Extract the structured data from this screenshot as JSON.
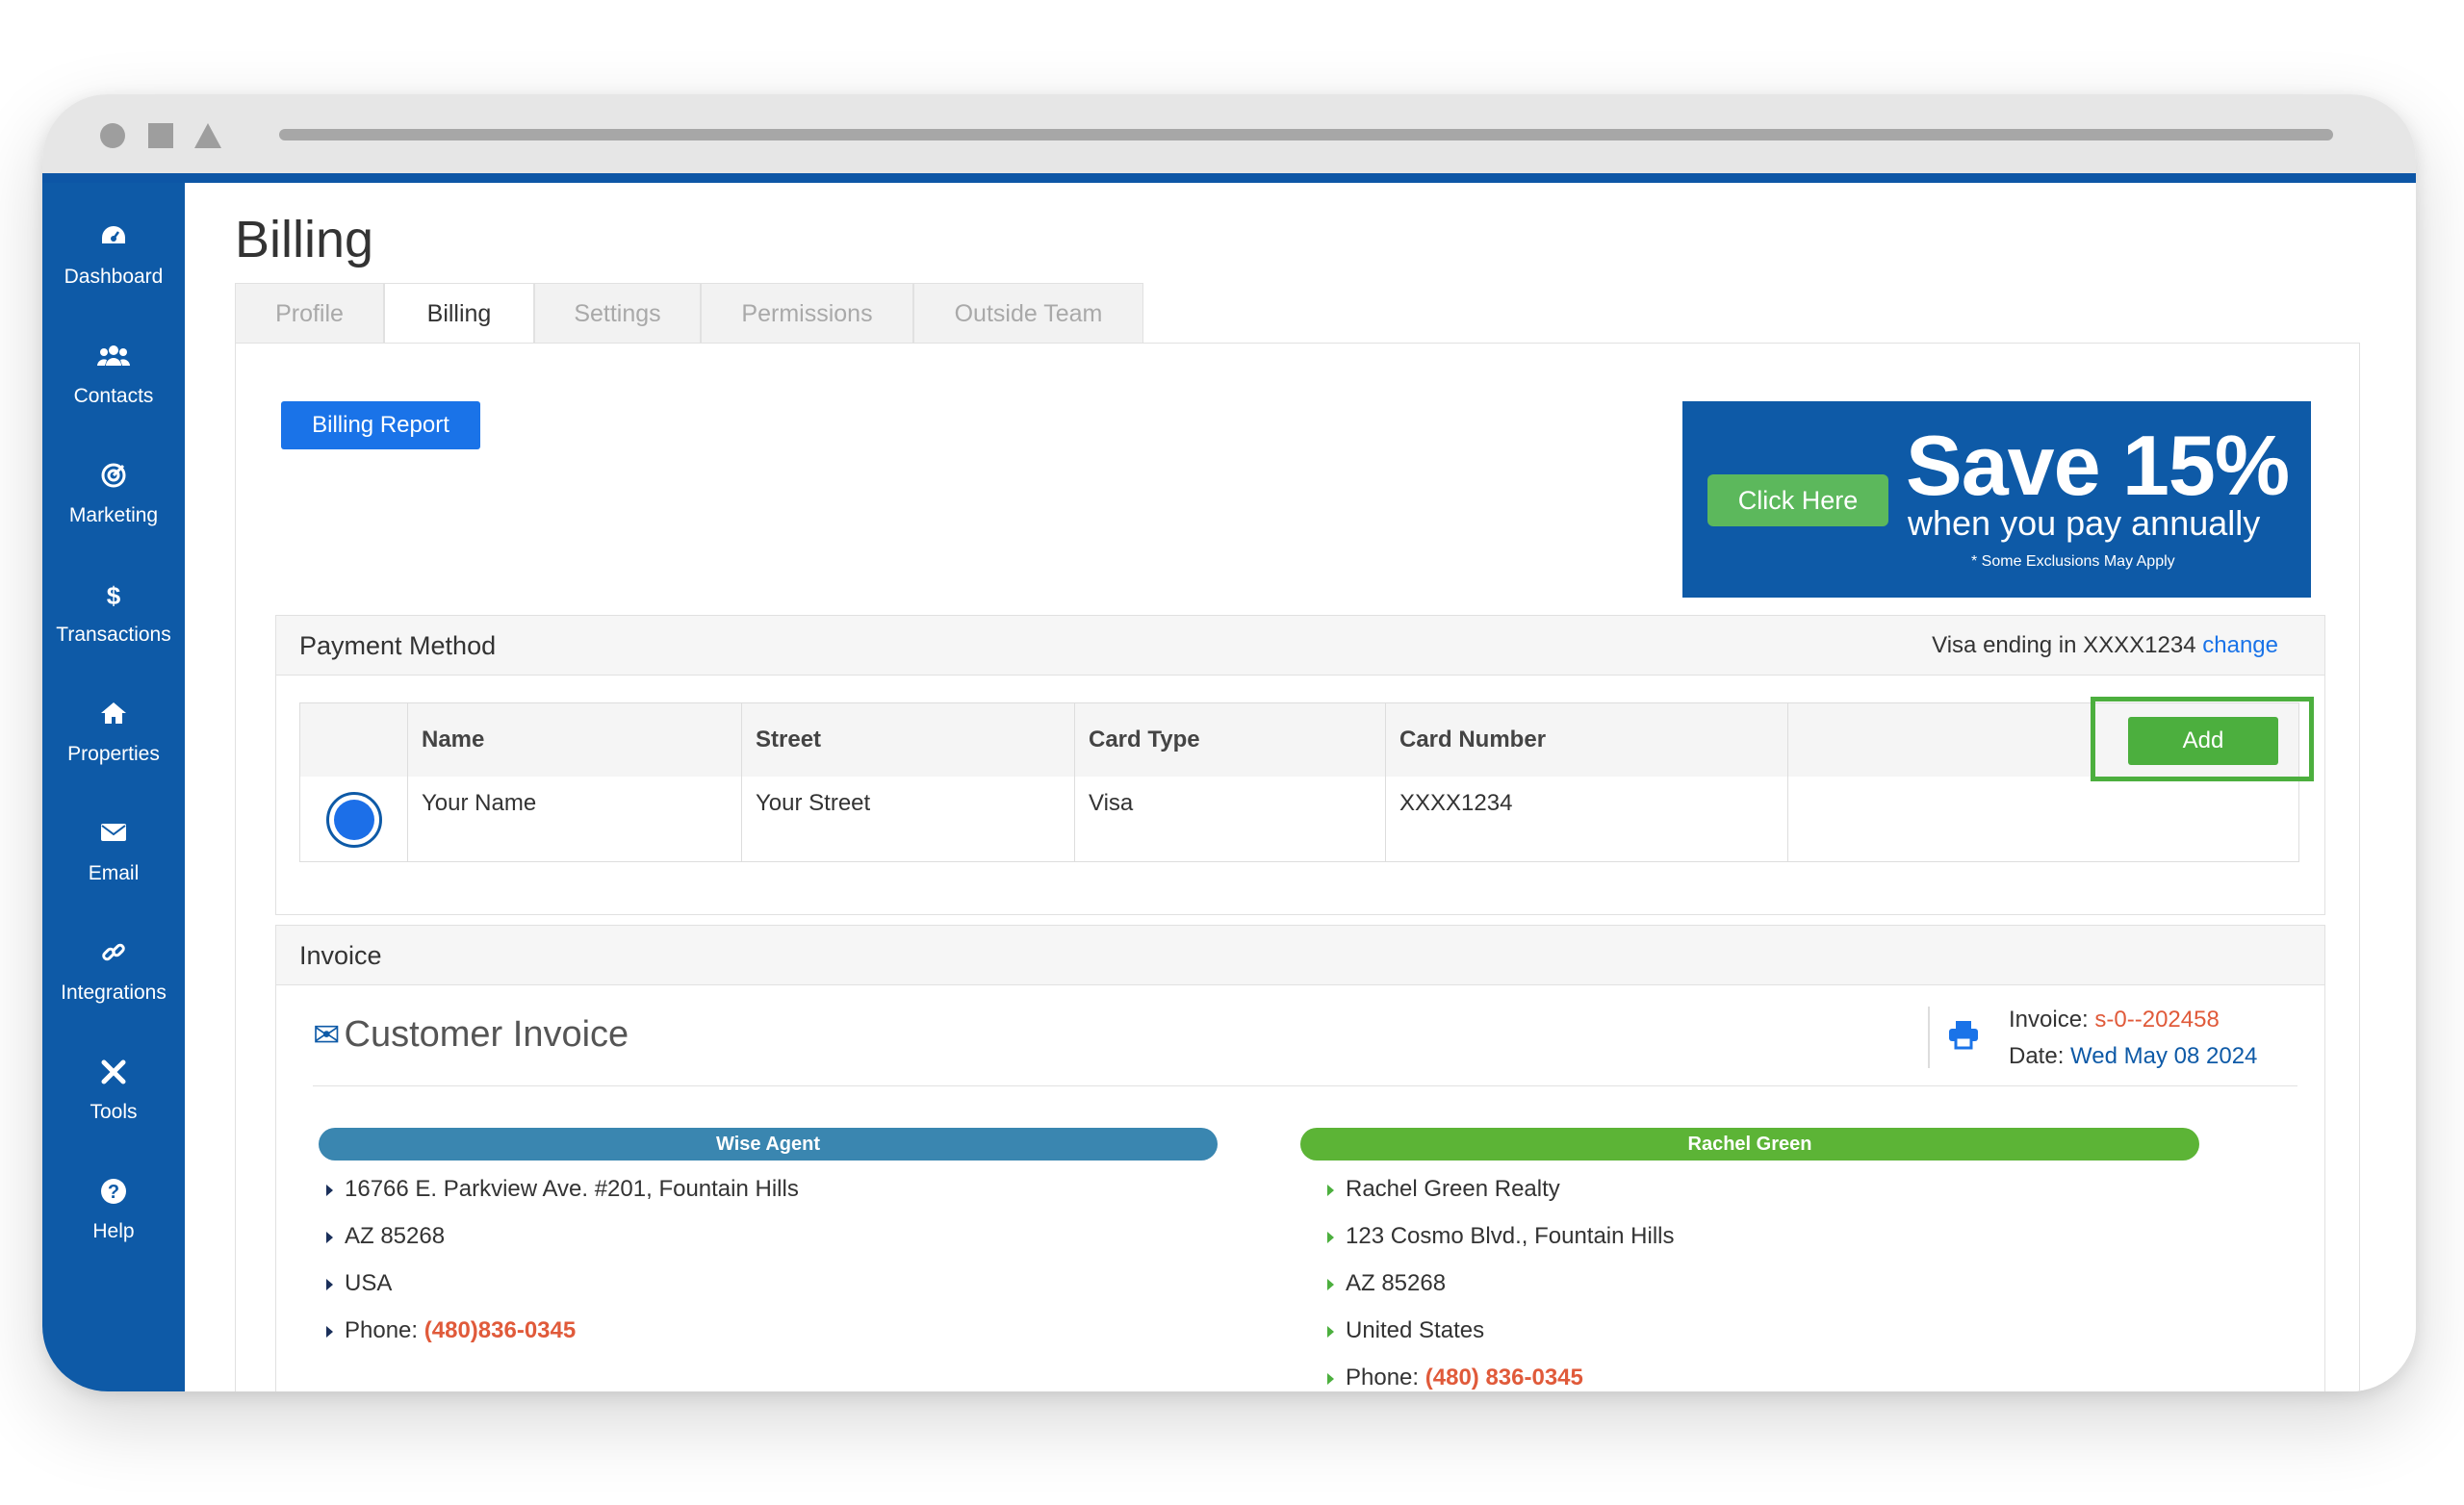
{
  "page": {
    "title": "Billing"
  },
  "tabs": [
    {
      "label": "Profile",
      "active": false
    },
    {
      "label": "Billing",
      "active": true
    },
    {
      "label": "Settings",
      "active": false
    },
    {
      "label": "Permissions",
      "active": false
    },
    {
      "label": "Outside Team",
      "active": false
    }
  ],
  "sidebar": {
    "items": [
      {
        "label": "Dashboard",
        "icon": "dashboard-icon"
      },
      {
        "label": "Contacts",
        "icon": "contacts-icon"
      },
      {
        "label": "Marketing",
        "icon": "marketing-icon"
      },
      {
        "label": "Transactions",
        "icon": "dollar-icon"
      },
      {
        "label": "Properties",
        "icon": "home-icon"
      },
      {
        "label": "Email",
        "icon": "envelope-icon"
      },
      {
        "label": "Integrations",
        "icon": "link-icon"
      },
      {
        "label": "Tools",
        "icon": "tools-icon"
      },
      {
        "label": "Help",
        "icon": "help-icon"
      }
    ]
  },
  "billing_report": {
    "label": "Billing Report"
  },
  "promo": {
    "cta": "Click Here",
    "headline": "Save 15%",
    "subline": "when you pay annually",
    "fine": "* Some Exclusions May Apply"
  },
  "payment": {
    "title": "Payment Method",
    "visa_text": "Visa ending in XXXX1234",
    "change_label": "change",
    "add_label": "Add",
    "columns": [
      "Name",
      "Street",
      "Card Type",
      "Card Number"
    ],
    "row": {
      "name": "Your Name",
      "street": "Your Street",
      "card_type": "Visa",
      "card_number": "XXXX1234"
    }
  },
  "invoice": {
    "section_title": "Invoice",
    "title": "Customer Invoice",
    "invoice_label": "Invoice:",
    "invoice_number": "s-0--202458",
    "date_label": "Date:",
    "date_value": "Wed May 08 2024",
    "from": {
      "name": "Wise Agent",
      "address": "16766 E. Parkview Ave. #201, Fountain Hills",
      "state_zip": "AZ  85268",
      "country": "USA",
      "phone_label": "Phone:",
      "phone": "(480)836-0345"
    },
    "to": {
      "name": "Rachel Green",
      "company": "Rachel Green Realty",
      "address": "123 Cosmo Blvd., Fountain Hills",
      "state_zip": "AZ  85268",
      "country": "United States",
      "phone_label": "Phone:",
      "phone": "(480) 836-0345"
    }
  },
  "colors": {
    "sidebar": "#0e5aa7",
    "primary_button": "#1a73e8",
    "success": "#4caf3e",
    "wise_agent_pill": "#3a86b0",
    "phone_red": "#e05a3a"
  }
}
